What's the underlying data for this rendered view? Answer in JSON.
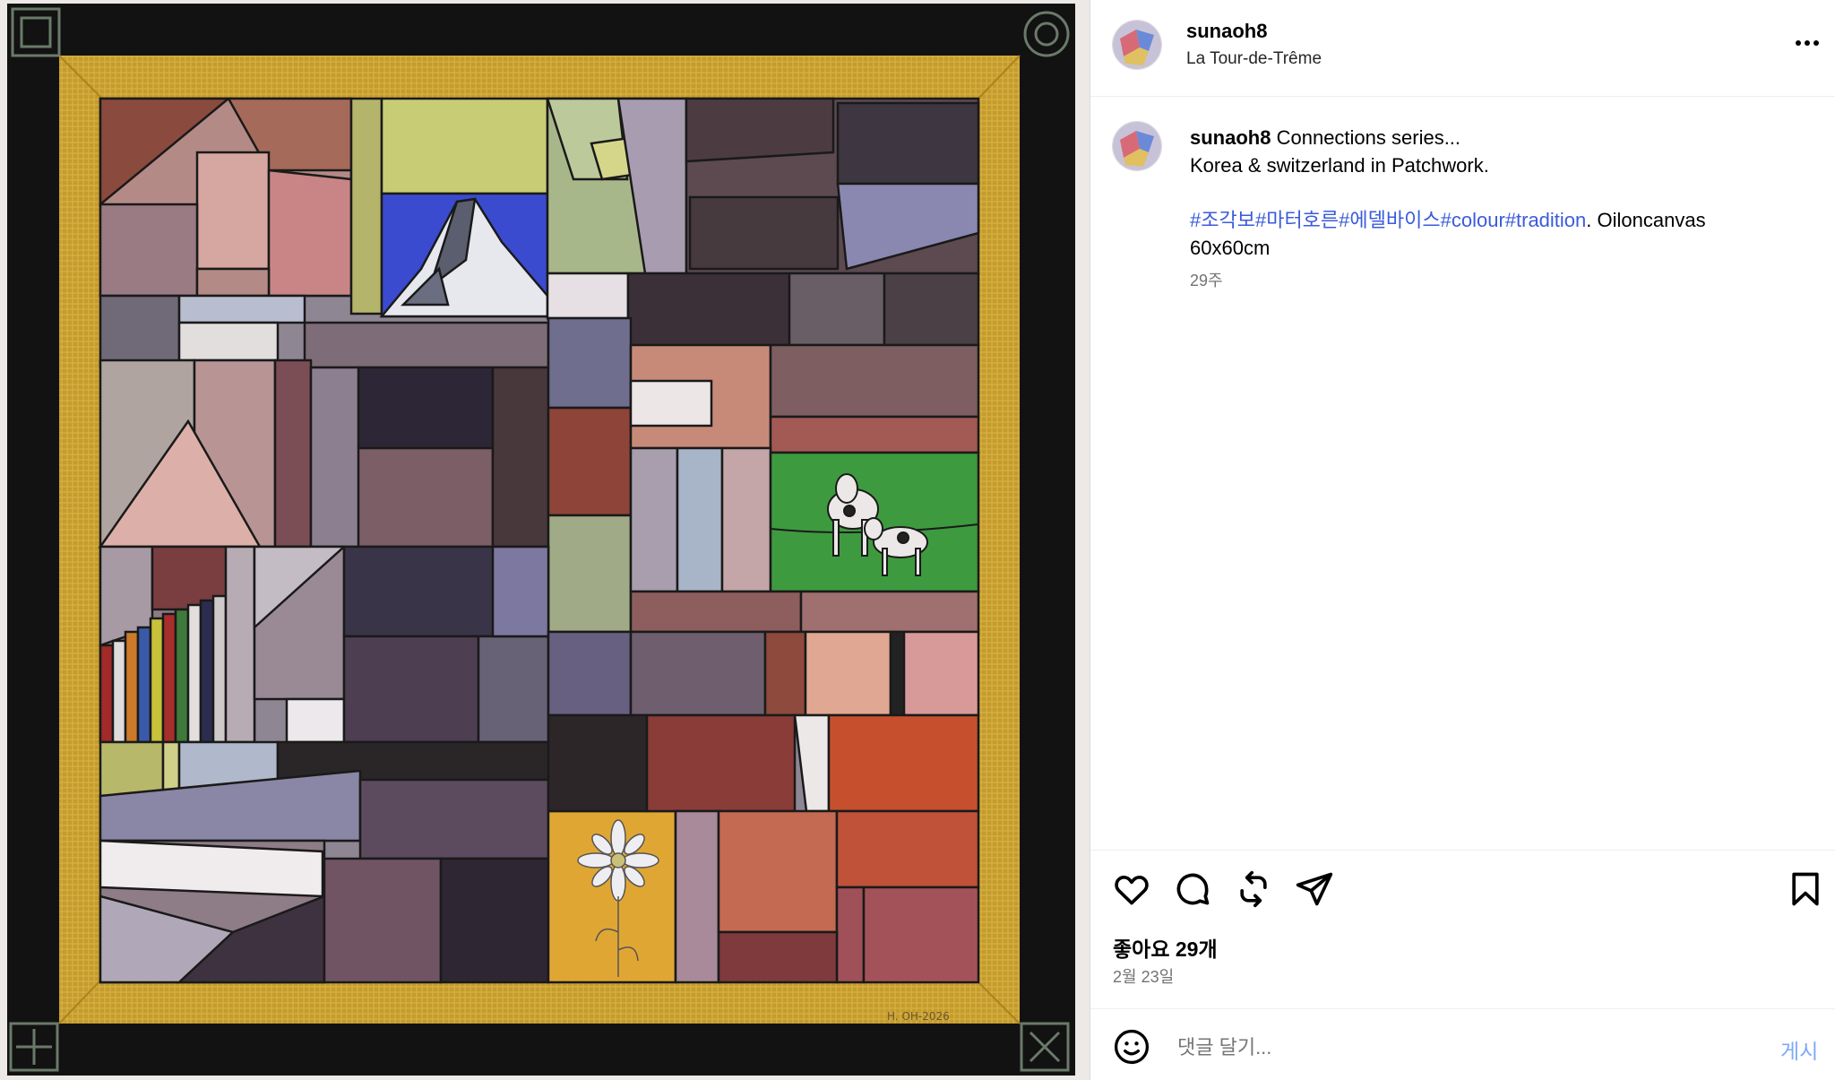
{
  "post": {
    "username": "sunaoh8",
    "location": "La Tour-de-Trême"
  },
  "caption": {
    "username": "sunaoh8",
    "line1": "Connections series...",
    "line2": "Korea & switzerland in Patchwork.",
    "hashtags": [
      "#조각보",
      "#마터호른",
      "#에델바이스",
      "#colour",
      "#tradition"
    ],
    "after_hashtags": ". Oiloncanvas",
    "line4": "60x60cm",
    "age": "29주"
  },
  "actions": {
    "like_icon": "heart-icon",
    "comment_icon": "comment-bubble-icon",
    "repost_icon": "repost-icon",
    "share_icon": "paper-plane-icon",
    "save_icon": "bookmark-icon"
  },
  "stats": {
    "likes": "좋아요 29개",
    "date": "2월 23일"
  },
  "comment": {
    "placeholder": "댓글 달기...",
    "post_button": "게시"
  },
  "artwork": {
    "signature": "H. OH-2026",
    "colors": {
      "frame_black": "#111111",
      "gold": "#c9a232",
      "green_field": "#3e9a3f",
      "sky_blue": "#3a4bd0"
    }
  },
  "colors": {
    "link": "#3b5bdb",
    "post_button": "#7fa9f7",
    "secondary_text": "#737373"
  }
}
